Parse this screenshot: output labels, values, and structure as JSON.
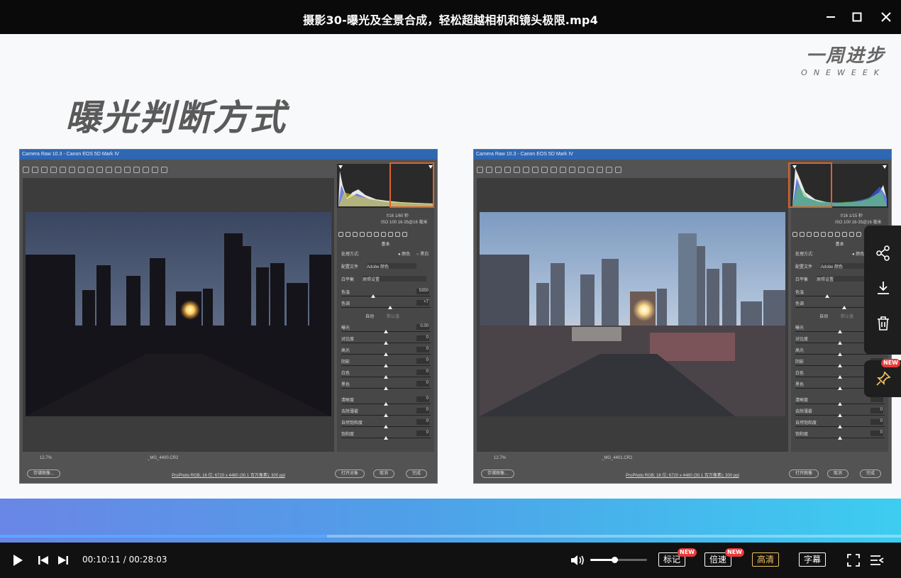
{
  "window": {
    "title": "摄影30-曝光及全景合成，轻松超越相机和镜头极限.mp4"
  },
  "slide": {
    "brand_cn": "一周进步",
    "brand_en": "ONEWEEK",
    "heading": "曝光判断方式",
    "left_window": {
      "title": "Camera Raw 10.3 -  Canon EOS 5D Mark IV",
      "meta_top": "f/16   1/60 秒",
      "meta_bottom": "ISO 100   16-35@16 毫米",
      "panel_name": "基本",
      "treatment_label": "处理方式:",
      "treatment_color": "颜色",
      "treatment_bw": "黑白",
      "profile_label": "配置文件",
      "profile_value": "Adobe 颜色",
      "wb_label": "白平衡",
      "wb_value": "原照设置",
      "sliders": [
        {
          "label": "色温",
          "value": "5350",
          "pos": 0.35
        },
        {
          "label": "色调",
          "value": "+7",
          "pos": 0.55
        }
      ],
      "auto": "自动",
      "default": "默认值",
      "tone": [
        {
          "label": "曝光",
          "value": "0.00",
          "pos": 0.5
        },
        {
          "label": "对比度",
          "value": "0",
          "pos": 0.5
        },
        {
          "label": "高光",
          "value": "0",
          "pos": 0.5
        },
        {
          "label": "阴影",
          "value": "0",
          "pos": 0.5
        },
        {
          "label": "白色",
          "value": "0",
          "pos": 0.5
        },
        {
          "label": "黑色",
          "value": "0",
          "pos": 0.5
        }
      ],
      "presence": [
        {
          "label": "清晰度",
          "value": "0",
          "pos": 0.5
        },
        {
          "label": "去除薄雾",
          "value": "0",
          "pos": 0.5
        },
        {
          "label": "自然饱和度",
          "value": "0",
          "pos": 0.5
        },
        {
          "label": "饱和度",
          "value": "0",
          "pos": 0.5
        }
      ],
      "zoom": "12.7%",
      "filename": "_MG_4400.CR2",
      "save_btn": "存储图像...",
      "info": "ProPhoto RGB; 16 位; 6720 x 4480 (30.1 百万像素); 300 ppi",
      "open_btn": "打开对象",
      "cancel_btn": "取消",
      "done_btn": "完成"
    },
    "right_window": {
      "title": "Camera Raw 10.3 -  Canon EOS 5D Mark IV",
      "meta_top": "f/16   1/15 秒",
      "meta_bottom": "ISO 100   16-35@16 毫米",
      "panel_name": "基本",
      "treatment_label": "处理方式:",
      "treatment_color": "颜色",
      "treatment_bw": "黑白",
      "profile_label": "配置文件",
      "profile_value": "Adobe 颜色",
      "wb_label": "白平衡",
      "wb_value": "原照设置",
      "sliders": [
        {
          "label": "色温",
          "value": "",
          "pos": 0.35
        },
        {
          "label": "色调",
          "value": "",
          "pos": 0.55
        }
      ],
      "auto": "自动",
      "default": "默认值",
      "tone": [
        {
          "label": "曝光",
          "value": "",
          "pos": 0.5
        },
        {
          "label": "对比度",
          "value": "",
          "pos": 0.5
        },
        {
          "label": "高光",
          "value": "",
          "pos": 0.5
        },
        {
          "label": "阴影",
          "value": "",
          "pos": 0.5
        },
        {
          "label": "白色",
          "value": "",
          "pos": 0.5
        },
        {
          "label": "黑色",
          "value": "",
          "pos": 0.5
        }
      ],
      "presence": [
        {
          "label": "清晰度",
          "value": "",
          "pos": 0.5
        },
        {
          "label": "去除薄雾",
          "value": "0",
          "pos": 0.5
        },
        {
          "label": "自然饱和度",
          "value": "0",
          "pos": 0.5
        },
        {
          "label": "饱和度",
          "value": "0",
          "pos": 0.5
        }
      ],
      "zoom": "12.7%",
      "filename": "_MG_4401.CR2",
      "save_btn": "存储图像...",
      "info": "ProPhoto RGB; 16 位; 6720 x 4480 (30.1 百万像素); 300 ppi",
      "open_btn": "打开图像",
      "cancel_btn": "取消",
      "done_btn": "完成"
    }
  },
  "side_toolbar": {
    "items": [
      "share-icon",
      "download-icon",
      "delete-icon",
      "pin-icon"
    ],
    "pin_badge": "NEW"
  },
  "player": {
    "current_time": "00:10:11",
    "total_time": "00:28:03",
    "progress": 0.363,
    "volume": 0.42,
    "mark_label": "标记",
    "mark_badge": "NEW",
    "speed_label": "倍速",
    "speed_badge": "NEW",
    "quality_label": "高清",
    "subtitle_label": "字幕"
  },
  "colors": {
    "accent": "#f0c060",
    "highlight_box": "#d8642f",
    "badge": "#e83a3a"
  }
}
